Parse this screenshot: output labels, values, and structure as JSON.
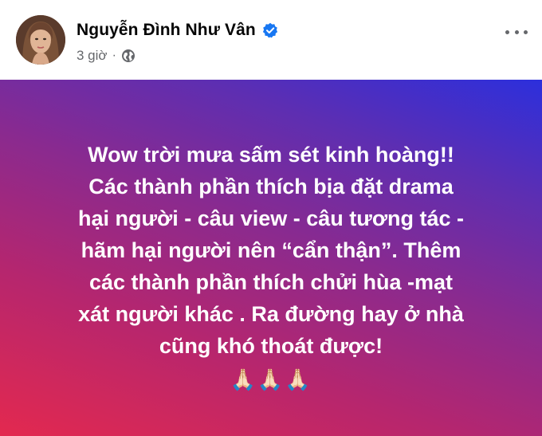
{
  "header": {
    "name": "Nguyễn Đình Như Vân",
    "time": "3 giờ",
    "separator": "·",
    "audience_icon": "globe-icon",
    "verified_icon": "verified-badge-icon",
    "more_icon": "more-options-icon"
  },
  "post": {
    "lines": [
      "Wow trời mưa sấm sét kinh hoàng!!",
      "Các thành phần thích bịa đặt drama",
      "hại người - câu view - câu tương tác -",
      "hãm hại người nên “cẩn thận”. Thêm",
      "các thành phần thích chửi hùa -mạt",
      "xát người khác . Ra đường hay ở nhà",
      "cũng khó thoát được!"
    ],
    "emoji": "🙏🏻🙏🏻🙏🏻",
    "background_colors": [
      "#e3294f",
      "#8a2a8f",
      "#2c2fdc"
    ]
  },
  "colors": {
    "name": "#050505",
    "meta": "#65676b",
    "verified": "#1877f2"
  }
}
